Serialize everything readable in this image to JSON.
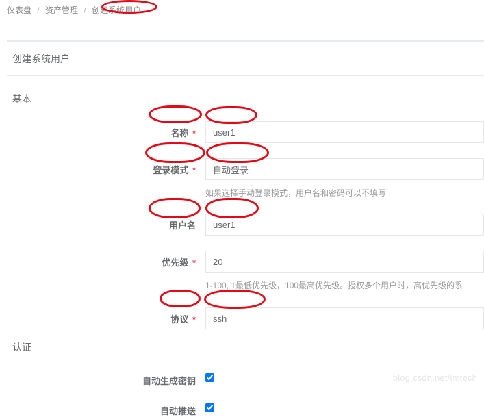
{
  "breadcrumb": {
    "items": [
      "仪表盘",
      "资产管理",
      "创建系统用户"
    ]
  },
  "panel": {
    "title": "创建系统用户"
  },
  "sections": {
    "basic": "基本",
    "auth": "认证"
  },
  "form": {
    "name": {
      "label": "名称",
      "value": "user1"
    },
    "login_mode": {
      "label": "登录模式",
      "value": "自动登录",
      "help": "如果选择手动登录模式，用户名和密码可以不填写"
    },
    "username": {
      "label": "用户名",
      "value": "user1"
    },
    "priority": {
      "label": "优先级",
      "value": "20",
      "help": "1-100, 1最低优先级，100最高优先级。授权多个用户时，高优先级的系"
    },
    "protocol": {
      "label": "协议",
      "value": "ssh"
    },
    "autogen_key": {
      "label": "自动生成密钥",
      "checked": true
    },
    "auto_push": {
      "label": "自动推送",
      "checked": true
    }
  },
  "watermark": "blog.csdn.net/imtech"
}
